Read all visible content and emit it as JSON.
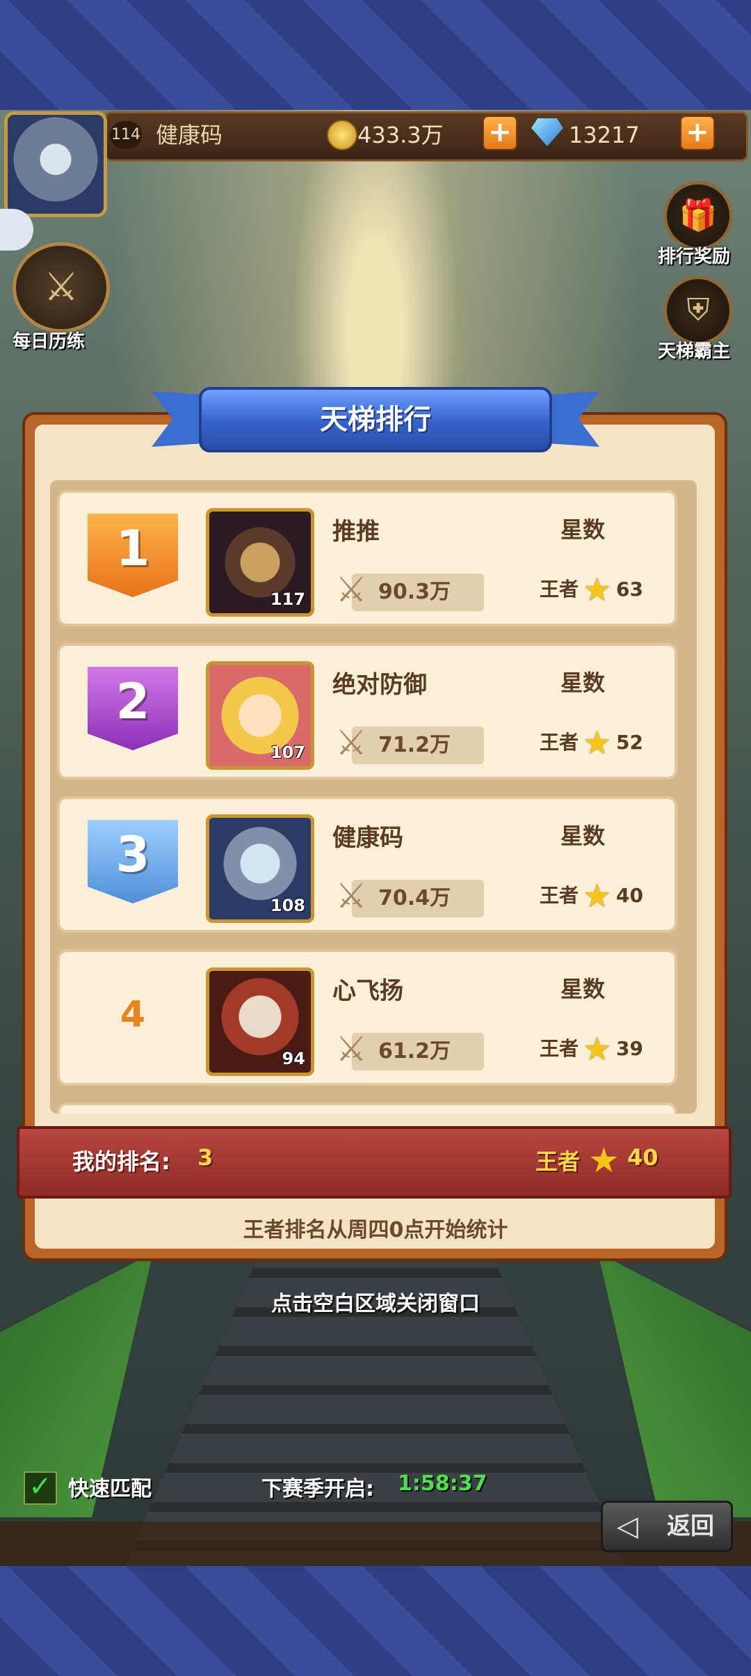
{
  "top_bar": {
    "level": "114",
    "player_name": "健康码",
    "gold": "433.3万",
    "gems": "13217"
  },
  "side_buttons": {
    "daily_training": "每日历练",
    "rank_rewards": "排行奖励",
    "ladder_master": "天梯霸主"
  },
  "modal": {
    "title": "天梯排行",
    "rows": [
      {
        "rank": "1",
        "name": "推推",
        "level": "117",
        "power": "90.3万",
        "star_header": "星数",
        "tier": "王者",
        "stars": "63"
      },
      {
        "rank": "2",
        "name": "绝对防御",
        "level": "107",
        "power": "71.2万",
        "star_header": "星数",
        "tier": "王者",
        "stars": "52"
      },
      {
        "rank": "3",
        "name": "健康码",
        "level": "108",
        "power": "70.4万",
        "star_header": "星数",
        "tier": "王者",
        "stars": "40"
      },
      {
        "rank": "4",
        "name": "心飞扬",
        "level": "94",
        "power": "61.2万",
        "star_header": "星数",
        "tier": "王者",
        "stars": "39"
      }
    ],
    "my_rank_label": "我的排名:",
    "my_rank_value": "3",
    "my_tier": "王者",
    "my_stars": "40",
    "notice": "王者排名从周四0点开始统计"
  },
  "close_hint": "点击空白区域关闭窗口",
  "bottom": {
    "quick_match": "快速匹配",
    "next_season_label": "下赛季开启:",
    "next_season_time": "1:58:37",
    "back": "返回"
  },
  "colors": {
    "modal_border": "#b8652a",
    "row_bg": "#faf0da",
    "title_ribbon": "#3562c9",
    "my_rank_bar": "#a0362f",
    "timer_green": "#4ee04a"
  }
}
